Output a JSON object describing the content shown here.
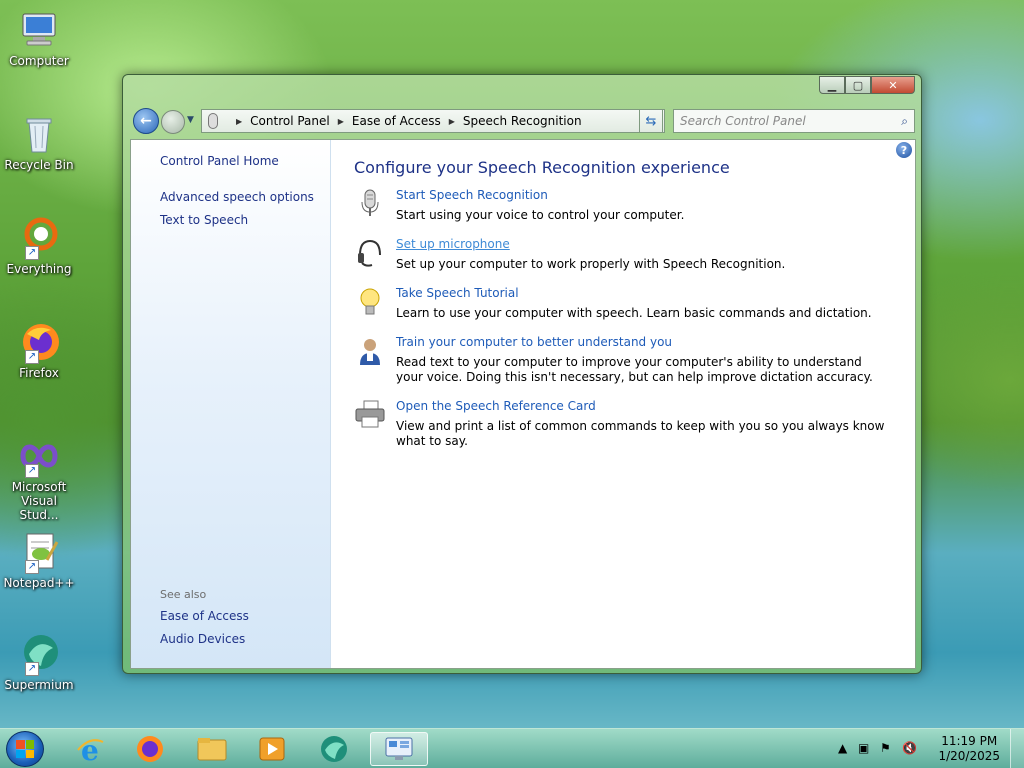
{
  "desktop": {
    "icons": [
      {
        "label": "Computer"
      },
      {
        "label": "Recycle Bin"
      },
      {
        "label": "Everything"
      },
      {
        "label": "Firefox"
      },
      {
        "label": "Microsoft Visual Stud..."
      },
      {
        "label": "Notepad++"
      },
      {
        "label": "Supermium"
      }
    ]
  },
  "window": {
    "address": {
      "crumbs": [
        "Control Panel",
        "Ease of Access",
        "Speech Recognition"
      ]
    },
    "search_placeholder": "Search Control Panel",
    "left_pane": {
      "home": "Control Panel Home",
      "links": [
        "Advanced speech options",
        "Text to Speech"
      ],
      "see_also_label": "See also",
      "see_also": [
        "Ease of Access",
        "Audio Devices"
      ]
    },
    "main": {
      "title": "Configure your Speech Recognition experience",
      "tasks": [
        {
          "link": "Start Speech Recognition",
          "desc": "Start using your voice to control your computer.",
          "icon": "microphone-icon"
        },
        {
          "link": "Set up microphone",
          "desc": "Set up your computer to work properly with Speech Recognition.",
          "icon": "headset-icon"
        },
        {
          "link": "Take Speech Tutorial",
          "desc": "Learn to use your computer with speech.  Learn basic commands and dictation.",
          "icon": "lightbulb-icon"
        },
        {
          "link": "Train your computer to better understand you",
          "desc": "Read text to your computer to improve your computer's ability to understand your voice. Doing this isn't necessary, but can help improve dictation accuracy.",
          "icon": "user-icon"
        },
        {
          "link": "Open the Speech Reference Card",
          "desc": "View and print a list of common commands to keep with you so you always know what to say.",
          "icon": "printer-icon"
        }
      ]
    }
  },
  "taskbar": {
    "clock": {
      "time": "11:19 PM",
      "date": "1/20/2025"
    }
  }
}
